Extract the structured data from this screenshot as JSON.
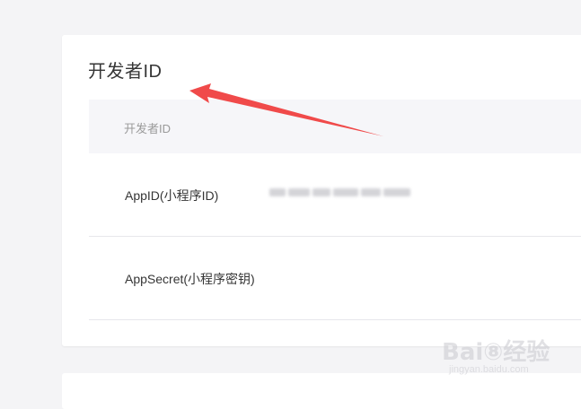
{
  "card": {
    "title": "开发者ID",
    "header_label": "开发者ID",
    "rows": [
      {
        "label": "AppID(小程序ID)",
        "value_masked": true
      },
      {
        "label": "AppSecret(小程序密钥)"
      }
    ]
  },
  "watermark": {
    "brand": "Bai⑧经验",
    "url": "jingyan.baidu.com"
  },
  "colors": {
    "arrow": "#f04a4a",
    "background": "#f4f4f6",
    "card": "#ffffff",
    "header_bg": "#f6f6f9"
  }
}
